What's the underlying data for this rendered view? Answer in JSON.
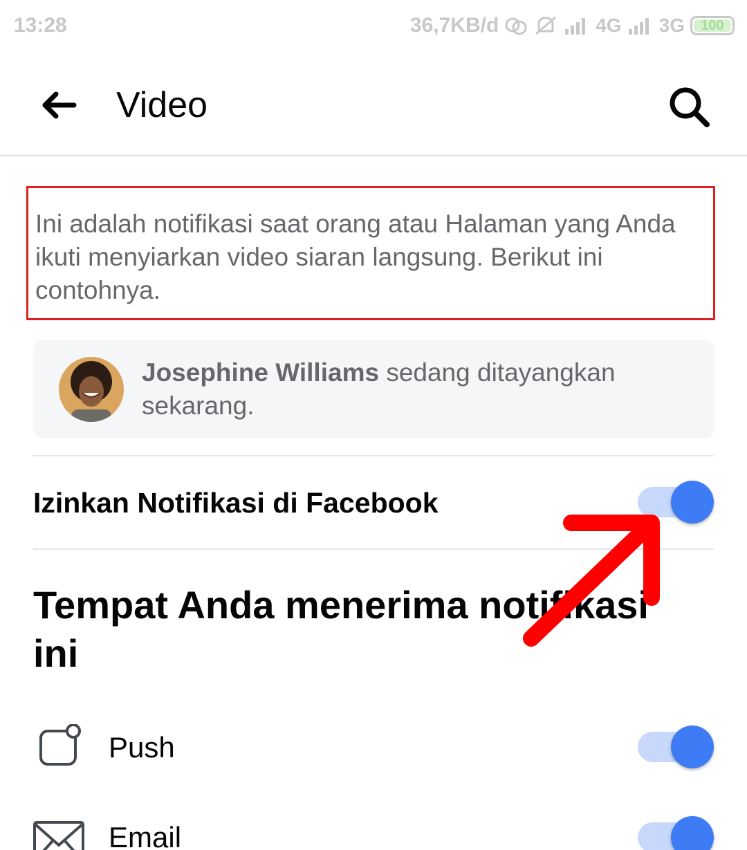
{
  "status_bar": {
    "time": "13:28",
    "speed": "36,7KB/d",
    "net1": "4G",
    "net2": "3G",
    "battery": "100"
  },
  "app_bar": {
    "title": "Video",
    "back_icon": "arrow-left-icon",
    "search_icon": "search-icon"
  },
  "description": "Ini adalah notifikasi saat orang atau Halaman yang Anda ikuti menyiarkan video siaran langsung. Berikut ini contohnya.",
  "preview": {
    "name": "Josephine Williams",
    "message": " sedang ditayangkan sekarang."
  },
  "allow_notifications": {
    "label": "Izinkan Notifikasi di Facebook",
    "enabled": true
  },
  "section_heading": "Tempat Anda menerima notifikasi ini",
  "channels": [
    {
      "label": "Push",
      "icon": "push-notification-icon",
      "enabled": true
    },
    {
      "label": "Email",
      "icon": "envelope-icon",
      "enabled": true
    }
  ],
  "colors": {
    "accent": "#3e7cf5",
    "track": "#c7d8fb",
    "highlight_border": "#e02020",
    "annotation_arrow": "#ff0000",
    "secondary_text": "#65676b"
  }
}
